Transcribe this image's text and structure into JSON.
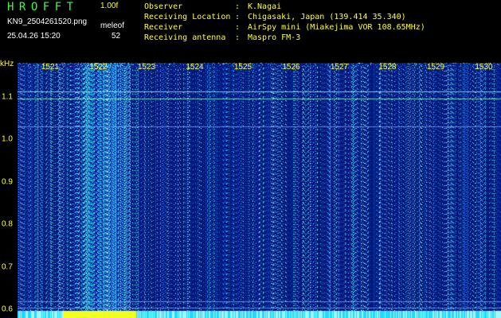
{
  "header": {
    "app_title": "HROFFT",
    "version": "1.00f",
    "filename": "KN9_2504261520.png",
    "mode_label": "meleof",
    "datetime": "25.04.26 15:20",
    "mode_value": "52"
  },
  "station": [
    {
      "key": "Observer",
      "sep": ":",
      "value": "K.Nagai"
    },
    {
      "key": "Receiving Location",
      "sep": ":",
      "value": "Chigasaki, Japan (139.414 35.340)"
    },
    {
      "key": "Receiver",
      "sep": ":",
      "value": "AirSpy mini (Miakejima VOR 108.65MHz)"
    },
    {
      "key": "Receiving antenna",
      "sep": ":",
      "value": "Maspro FM-3"
    }
  ],
  "y_unit": "kHz",
  "x_ticks": [
    "1521",
    "1522",
    "1523",
    "1524",
    "1525",
    "1526",
    "1527",
    "1528",
    "1529",
    "1530"
  ],
  "y_ticks": [
    "1.1",
    "1.0",
    "0.9",
    "0.8",
    "0.7",
    "0.6"
  ],
  "colors": {
    "background": "#04127a",
    "text_white": "#ffffff",
    "text_yellow": "#ffff33",
    "title_green": "#33ff33",
    "signal": "#39e6ff"
  },
  "chart_data": {
    "type": "heatmap",
    "xlabel": "",
    "ylabel": "kHz",
    "x_ticks": [
      "1521",
      "1522",
      "1523",
      "1524",
      "1525",
      "1526",
      "1527",
      "1528",
      "1529",
      "1530"
    ],
    "y_ticks": [
      1.1,
      1.0,
      0.9,
      0.8,
      0.7,
      0.6
    ],
    "ylim": [
      0.58,
      1.18
    ],
    "x_start_tick": "1521",
    "bright_band": {
      "from_tick": "1521.5",
      "to_tick": "1522.7"
    },
    "horizontal_lines_khz": [
      1.112,
      1.095,
      1.03,
      0.62,
      0.605
    ]
  }
}
